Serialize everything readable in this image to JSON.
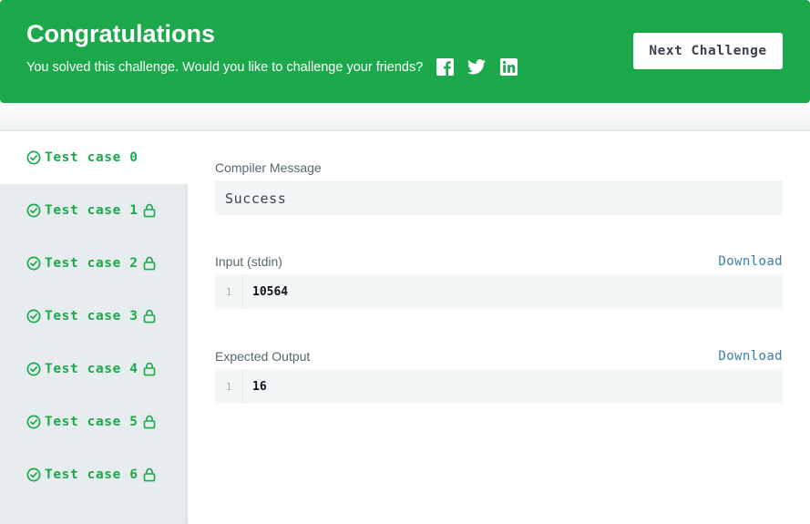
{
  "banner": {
    "title": "Congratulations",
    "subtitle": "You solved this challenge. Would you like to challenge your friends?",
    "social_icons": [
      "facebook-icon",
      "twitter-icon",
      "linkedin-icon"
    ],
    "next_label": "Next Challenge",
    "bg_color": "#1ba94c"
  },
  "sidebar": {
    "tabs": [
      {
        "label": "Test case 0",
        "locked": false,
        "active": true
      },
      {
        "label": "Test case 1",
        "locked": true,
        "active": false
      },
      {
        "label": "Test case 2",
        "locked": true,
        "active": false
      },
      {
        "label": "Test case 3",
        "locked": true,
        "active": false
      },
      {
        "label": "Test case 4",
        "locked": true,
        "active": false
      },
      {
        "label": "Test case 5",
        "locked": true,
        "active": false
      },
      {
        "label": "Test case 6",
        "locked": true,
        "active": false
      }
    ]
  },
  "result": {
    "compiler_label": "Compiler Message",
    "compiler_message": "Success",
    "input_label": "Input (stdin)",
    "input_download": "Download",
    "input_line_no": "1",
    "input_value": "10564",
    "expected_label": "Expected Output",
    "expected_download": "Download",
    "expected_line_no": "1",
    "expected_value": "16"
  }
}
